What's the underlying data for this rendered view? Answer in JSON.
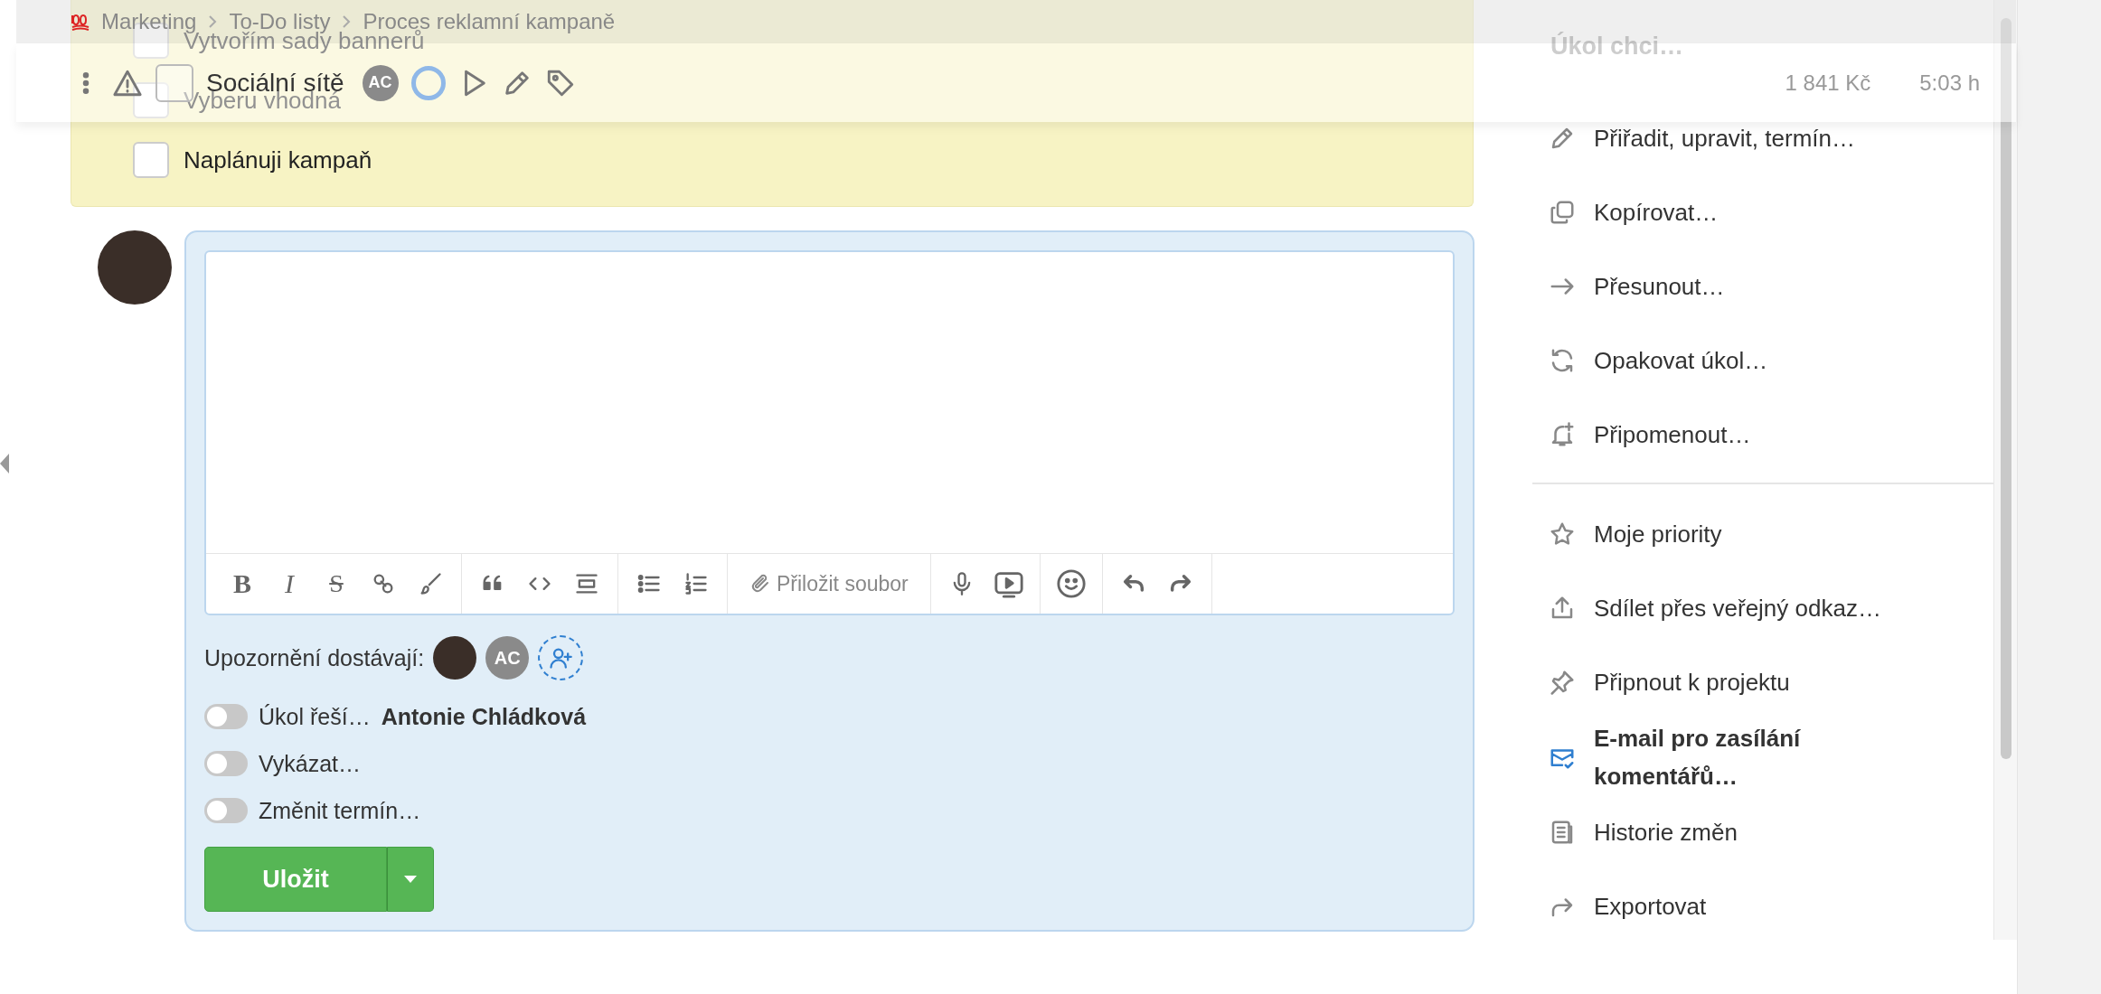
{
  "breadcrumb": [
    {
      "label": "Marketing"
    },
    {
      "label": "To-Do listy"
    },
    {
      "label": "Proces reklamní kampaně"
    }
  ],
  "task_bar": {
    "title": "Sociální sítě",
    "checked": false,
    "assignee": "AC",
    "price": "1 841 Kč",
    "time": "5:03 h"
  },
  "checklist": [
    {
      "label": "Vytvořím sady bannerů",
      "checked": false
    },
    {
      "label": "Vyberu vhodná",
      "checked": false
    },
    {
      "label": "Naplánuji kampaň",
      "checked": false
    }
  ],
  "comment": {
    "toolbar": [
      [
        {
          "kind": "bold",
          "glyph": "B"
        },
        {
          "kind": "italic",
          "glyph": "I"
        },
        {
          "kind": "strike",
          "glyph": "S"
        },
        {
          "kind": "link"
        },
        {
          "kind": "brush"
        }
      ],
      [
        {
          "kind": "quote"
        },
        {
          "kind": "code"
        },
        {
          "kind": "block"
        }
      ],
      [
        {
          "kind": "bullets"
        },
        {
          "kind": "numbers"
        }
      ],
      [
        {
          "kind": "attach",
          "label": "Přiložit soubor"
        }
      ],
      [
        {
          "kind": "mic"
        },
        {
          "kind": "video"
        }
      ],
      [
        {
          "kind": "emoji"
        }
      ],
      [
        {
          "kind": "undo"
        },
        {
          "kind": "redo"
        }
      ]
    ],
    "notify_label": "Upozornění dostávají:",
    "notify_initials": "AC",
    "options": [
      {
        "label": "Úkol řeší…",
        "value": "Antonie Chládková",
        "on": false
      },
      {
        "label": "Vykázat…",
        "on": false
      },
      {
        "label": "Změnit termín…",
        "on": false
      }
    ],
    "save": "Uložit"
  },
  "menu": {
    "heading": "Úkol chci…",
    "groups": [
      [
        {
          "kind": "pencil",
          "label": "Přiřadit, upravit, termín…",
          "highlighted": false
        },
        {
          "kind": "copy",
          "label": "Kopírovat…",
          "highlighted": false
        },
        {
          "kind": "arrow",
          "label": "Přesunout…",
          "highlighted": false
        },
        {
          "kind": "repeat",
          "label": "Opakovat úkol…",
          "highlighted": false
        },
        {
          "kind": "bell",
          "label": "Připomenout…",
          "highlighted": false
        }
      ],
      [
        {
          "kind": "star",
          "label": "Moje priority",
          "highlighted": false
        },
        {
          "kind": "share",
          "label": "Sdílet přes veřejný odkaz…",
          "highlighted": false
        },
        {
          "kind": "pin",
          "label": "Připnout k projektu",
          "highlighted": false
        },
        {
          "kind": "mail",
          "label": "E-mail pro zasílání komentářů…",
          "highlighted": true
        },
        {
          "kind": "history",
          "label": "Historie změn",
          "highlighted": false
        },
        {
          "kind": "export",
          "label": "Exportovat",
          "highlighted": false
        }
      ]
    ]
  }
}
